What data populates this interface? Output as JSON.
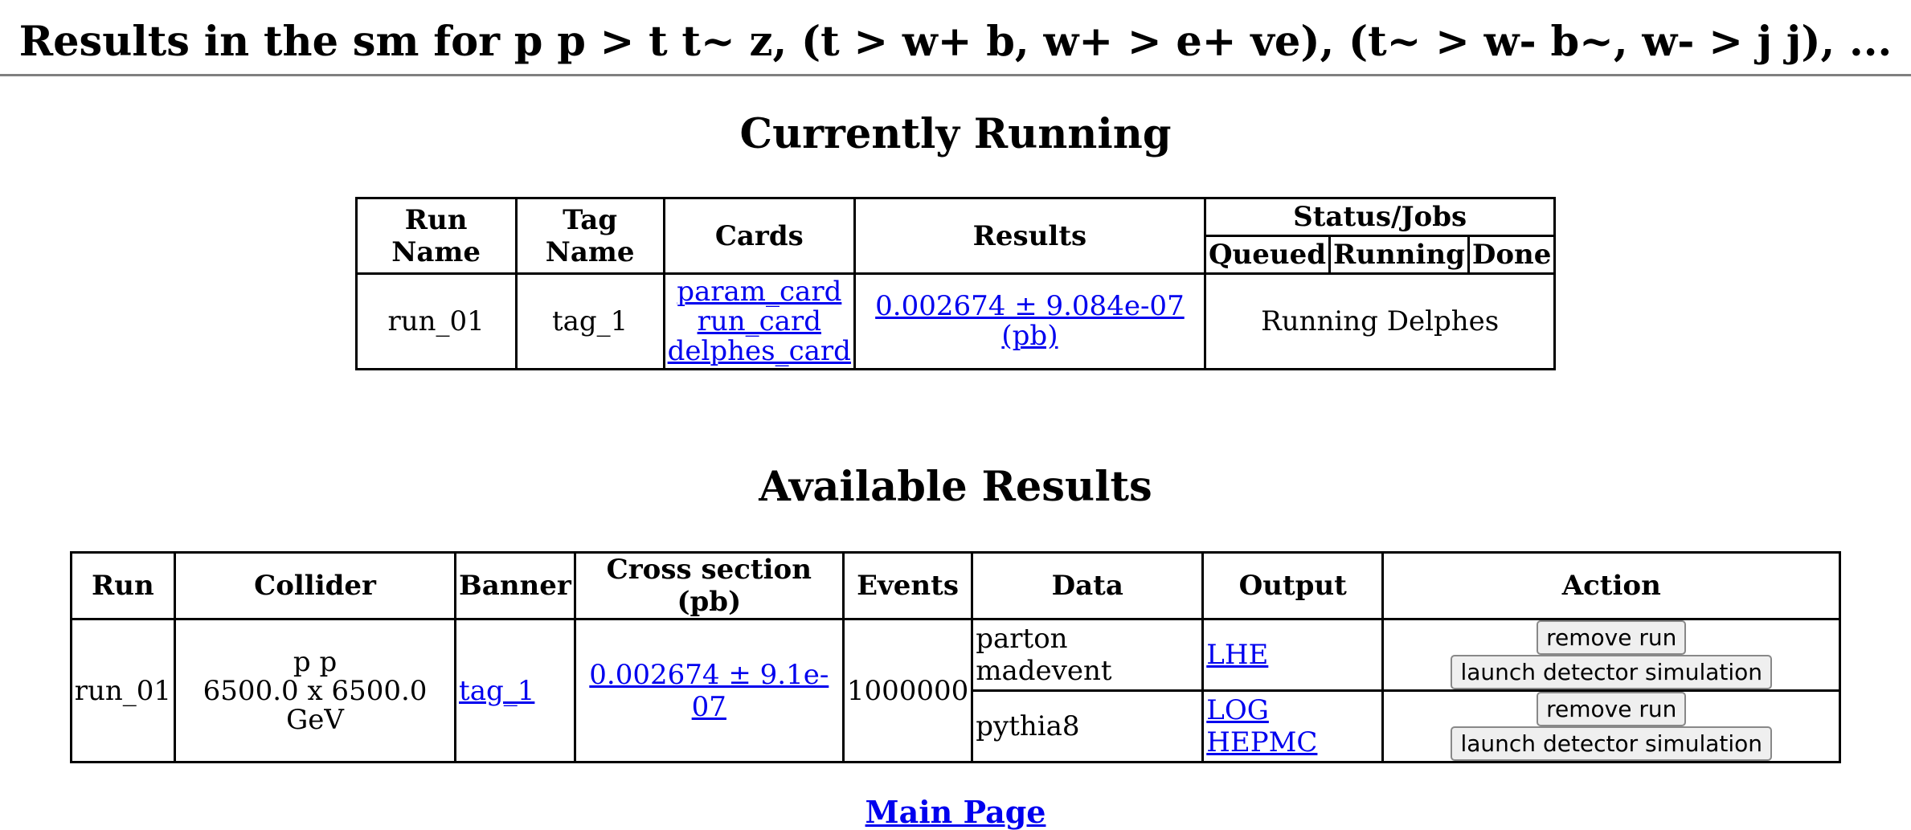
{
  "header": {
    "title": "Results in the sm for p p > t t~ z, (t > w+ b, w+ > e+ ve), (t~ > w- b~, w- > j j), ..."
  },
  "running": {
    "title": "Currently Running",
    "headers": {
      "run_name": "Run Name",
      "tag_name": "Tag Name",
      "cards": "Cards",
      "results": "Results",
      "status_jobs": "Status/Jobs",
      "queued": "Queued",
      "running": "Running",
      "done": "Done"
    },
    "row": {
      "run_name": "run_01",
      "tag_name": "tag_1",
      "cards": [
        "param_card",
        "run_card",
        "delphes_card"
      ],
      "results": "0.002674 ± 9.084e-07 (pb)",
      "status": "Running Delphes"
    }
  },
  "available": {
    "title": "Available Results",
    "headers": {
      "run": "Run",
      "collider": "Collider",
      "banner": "Banner",
      "cross_section": "Cross section (pb)",
      "events": "Events",
      "data": "Data",
      "output": "Output",
      "action": "Action"
    },
    "row": {
      "run": "run_01",
      "collider_line1": "p p",
      "collider_line2": "6500.0 x 6500.0 GeV",
      "banner": "tag_1",
      "cross_section": "0.002674 ± 9.1e-07",
      "events": "1000000",
      "data": [
        {
          "name": "parton madevent",
          "outputs": [
            "LHE"
          ]
        },
        {
          "name": "pythia8",
          "outputs": [
            "LOG",
            "HEPMC"
          ]
        }
      ],
      "remove_label": "remove run",
      "launch_label": "launch detector simulation"
    }
  },
  "footer": {
    "main_page": "Main Page"
  }
}
